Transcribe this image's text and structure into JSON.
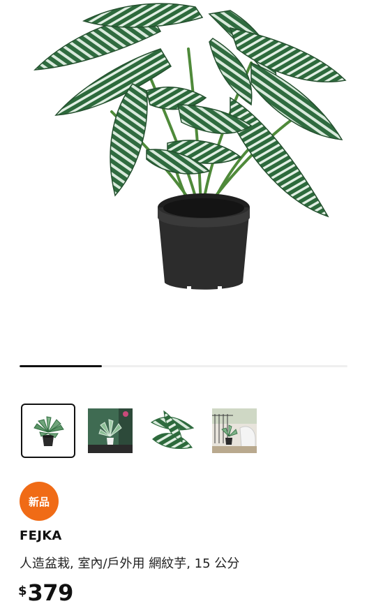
{
  "gallery": {
    "progress_fraction": 0.25,
    "thumbnails": [
      {
        "icon": "plant-pot-thumbnail",
        "selected": true
      },
      {
        "icon": "plant-room-thumbnail",
        "selected": false
      },
      {
        "icon": "leaf-closeup-thumbnail",
        "selected": false
      },
      {
        "icon": "plant-balcony-thumbnail",
        "selected": false
      }
    ]
  },
  "product": {
    "badge": "新品",
    "name": "FEJKA",
    "description": "人造盆栽, 室內/戶外用 網紋芋, 15 公分",
    "price_currency": "$",
    "price_amount": "379"
  },
  "colors": {
    "badge": "#f06b16",
    "leaf_dark": "#2f6b3f",
    "leaf_light": "#d9eadc",
    "pot": "#2a2a2a"
  }
}
